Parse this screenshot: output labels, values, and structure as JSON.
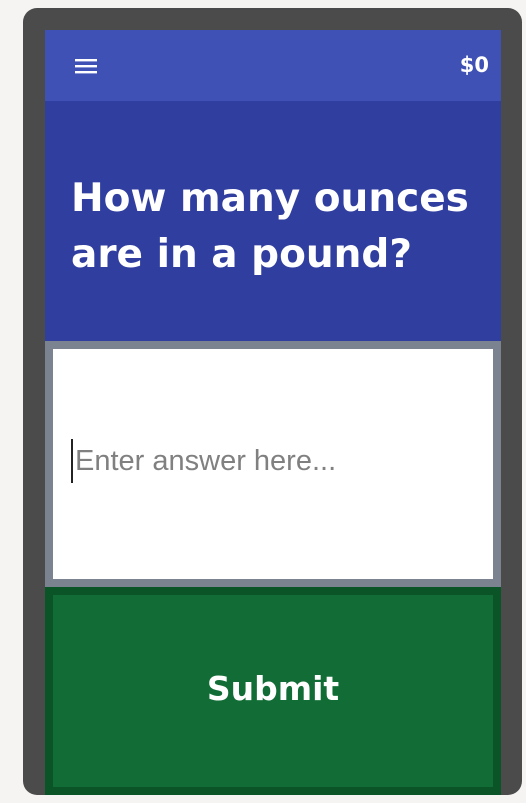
{
  "topbar": {
    "menu_icon": "hamburger-menu-icon",
    "balance": "$0",
    "color": "#3f51b5"
  },
  "question": {
    "text": "How many ounces are in a pound?",
    "background": "#303f9f"
  },
  "answer": {
    "value": "",
    "placeholder": "Enter answer here..."
  },
  "submit": {
    "label": "Submit",
    "color": "#116d35"
  }
}
